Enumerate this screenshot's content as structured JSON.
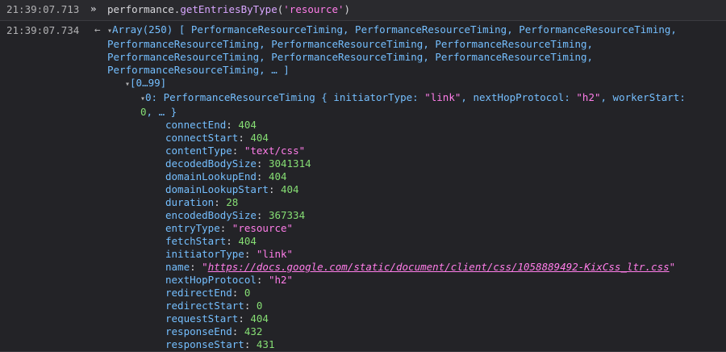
{
  "input": {
    "timestamp": "21:39:07.713",
    "prompt": "»",
    "cmd_object": "performance.",
    "cmd_method": "getEntriesByType",
    "cmd_paren_open": "(",
    "cmd_arg": "'resource'",
    "cmd_paren_close": ")"
  },
  "output": {
    "timestamp": "21:39:07.734",
    "return_arrow": "←",
    "twisty": "▾",
    "array_summary": "Array(250) [ PerformanceResourceTiming, PerformanceResourceTiming, PerformanceResourceTiming, PerformanceResourceTiming, PerformanceResourceTiming, PerformanceResourceTiming, PerformanceResourceTiming, PerformanceResourceTiming, PerformanceResourceTiming, PerformanceResourceTiming, … ]",
    "range_label": "[0…99]",
    "item0_index": "0:",
    "item0_prefix": " PerformanceResourceTiming { initiatorType: ",
    "item0_initiator": "\"link\"",
    "item0_mid": ", nextHopProtocol: ",
    "item0_protocol": "\"h2\"",
    "item0_suffix": ", workerStart:",
    "item0_tail_num": "0",
    "item0_tail_rest": ", … }",
    "properties": [
      {
        "key": "connectEnd",
        "value": "404",
        "type": "num"
      },
      {
        "key": "connectStart",
        "value": "404",
        "type": "num"
      },
      {
        "key": "contentType",
        "value": "\"text/css\"",
        "type": "str"
      },
      {
        "key": "decodedBodySize",
        "value": "3041314",
        "type": "num"
      },
      {
        "key": "domainLookupEnd",
        "value": "404",
        "type": "num"
      },
      {
        "key": "domainLookupStart",
        "value": "404",
        "type": "num"
      },
      {
        "key": "duration",
        "value": "28",
        "type": "num"
      },
      {
        "key": "encodedBodySize",
        "value": "367334",
        "type": "num"
      },
      {
        "key": "entryType",
        "value": "\"resource\"",
        "type": "str"
      },
      {
        "key": "fetchStart",
        "value": "404",
        "type": "num"
      },
      {
        "key": "initiatorType",
        "value": "\"link\"",
        "type": "str"
      },
      {
        "key": "name",
        "value_pre": "\"",
        "value_url": "https://docs.google.com/static/document/client/css/1058889492-KixCss_ltr.css",
        "value_post": "\"",
        "type": "url"
      },
      {
        "key": "nextHopProtocol",
        "value": "\"h2\"",
        "type": "str"
      },
      {
        "key": "redirectEnd",
        "value": "0",
        "type": "num"
      },
      {
        "key": "redirectStart",
        "value": "0",
        "type": "num"
      },
      {
        "key": "requestStart",
        "value": "404",
        "type": "num"
      },
      {
        "key": "responseEnd",
        "value": "432",
        "type": "num"
      },
      {
        "key": "responseStart",
        "value": "431",
        "type": "num"
      }
    ]
  },
  "colors": {
    "background": "#232327",
    "key": "#75bfff",
    "number": "#86de74",
    "string": "#ff7de9",
    "method": "#d8a6ff"
  }
}
